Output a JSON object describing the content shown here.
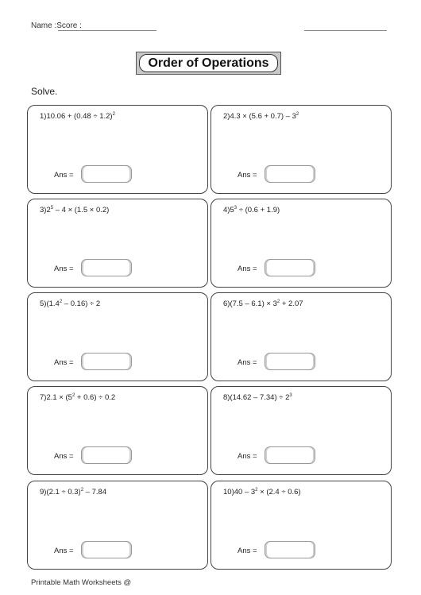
{
  "header": {
    "name_label": "Name :",
    "score_label": "Score :"
  },
  "title": "Order of Operations",
  "instruction": "Solve.",
  "answer_label": "Ans =",
  "problems": [
    {
      "num": "1)",
      "parts": [
        {
          "t": "10.06 + (0.48 ÷ 1.2)"
        },
        {
          "sup": "2"
        }
      ]
    },
    {
      "num": "2)",
      "parts": [
        {
          "t": "4.3 × (5.6 + 0.7) – 3"
        },
        {
          "sup": "2"
        }
      ]
    },
    {
      "num": "3)",
      "parts": [
        {
          "t": "2"
        },
        {
          "sup": "5"
        },
        {
          "t": " – 4 × (1.5 × 0.2)"
        }
      ]
    },
    {
      "num": "4)",
      "parts": [
        {
          "t": "5"
        },
        {
          "sup": "3"
        },
        {
          "t": " ÷ (0.6 + 1.9)"
        }
      ]
    },
    {
      "num": "5)",
      "parts": [
        {
          "t": "(1.4"
        },
        {
          "sup": "2"
        },
        {
          "t": " – 0.16) ÷ 2"
        }
      ]
    },
    {
      "num": "6)",
      "parts": [
        {
          "t": "(7.5 – 6.1) × 3"
        },
        {
          "sup": "2"
        },
        {
          "t": " + 2.07"
        }
      ]
    },
    {
      "num": "7)",
      "parts": [
        {
          "t": "2.1 × (5"
        },
        {
          "sup": "2"
        },
        {
          "t": " + 0.6) ÷ 0.2"
        }
      ]
    },
    {
      "num": "8)",
      "parts": [
        {
          "t": "(14.62 – 7.34) ÷ 2"
        },
        {
          "sup": "3"
        }
      ]
    },
    {
      "num": "9)",
      "parts": [
        {
          "t": "(2.1 ÷ 0.3)"
        },
        {
          "sup": "2"
        },
        {
          "t": " – 7.84"
        }
      ]
    },
    {
      "num": "10)",
      "parts": [
        {
          "t": "40 – 3"
        },
        {
          "sup": "2"
        },
        {
          "t": " × (2.4 ÷ 0.6)"
        }
      ]
    }
  ],
  "footer": "Printable Math Worksheets @"
}
